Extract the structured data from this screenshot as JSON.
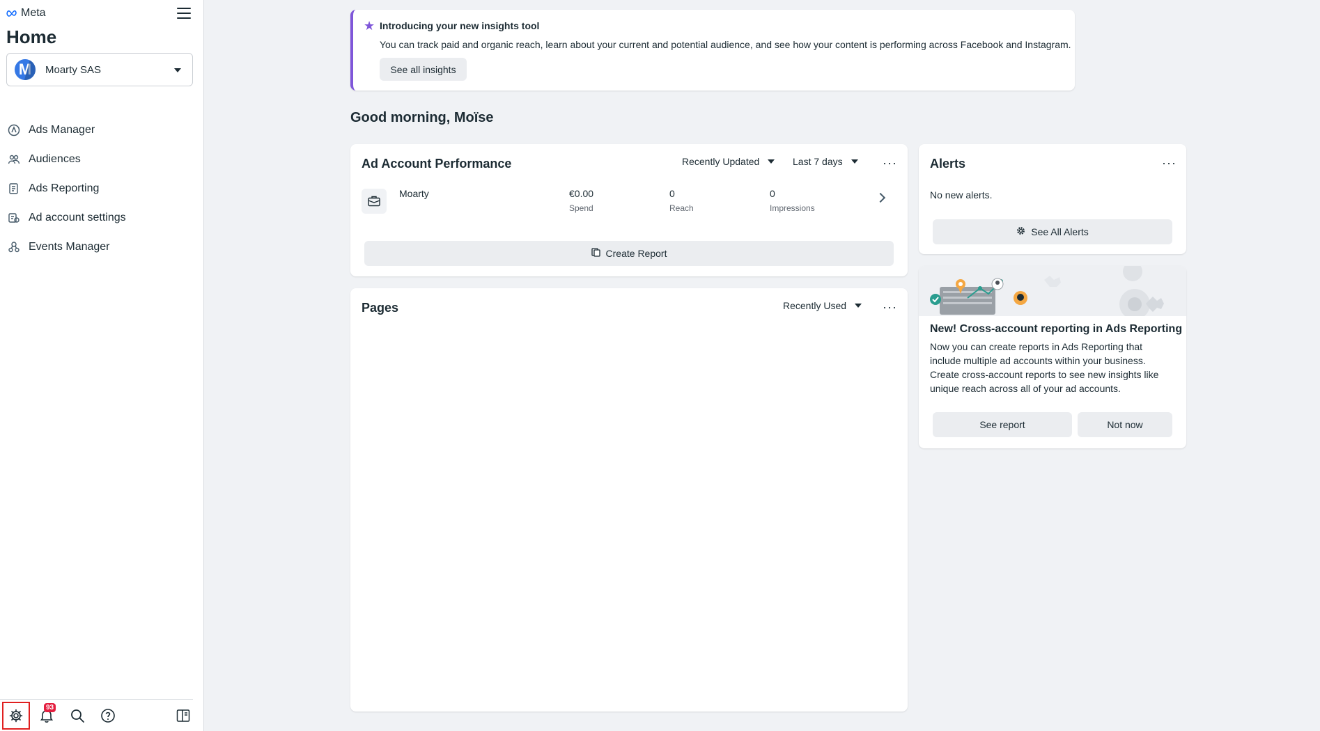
{
  "brand": {
    "name": "Meta"
  },
  "sidebar": {
    "title": "Home",
    "account": {
      "name": "Moarty SAS",
      "avatar_letter": "M"
    },
    "items": [
      {
        "label": "Ads Manager",
        "icon": "ads-manager-icon"
      },
      {
        "label": "Audiences",
        "icon": "audiences-icon"
      },
      {
        "label": "Ads Reporting",
        "icon": "ads-reporting-icon"
      },
      {
        "label": "Ad account settings",
        "icon": "ad-account-settings-icon"
      },
      {
        "label": "Events Manager",
        "icon": "events-manager-icon"
      }
    ],
    "bottom": {
      "notifications_badge": "93"
    }
  },
  "banner": {
    "title": "Introducing your new insights tool",
    "text": "You can track paid and organic reach, learn about your current and potential audience, and see how your content is performing across Facebook and Instagram.",
    "button": "See all insights"
  },
  "greeting": "Good morning, Moïse",
  "performance": {
    "title": "Ad Account Performance",
    "sort": "Recently Updated",
    "range": "Last 7 days",
    "row": {
      "name": "Moarty",
      "spend_value": "€0.00",
      "spend_label": "Spend",
      "reach_value": "0",
      "reach_label": "Reach",
      "impressions_value": "0",
      "impressions_label": "Impressions"
    },
    "button": "Create Report"
  },
  "pages": {
    "title": "Pages",
    "sort": "Recently Used"
  },
  "alerts": {
    "title": "Alerts",
    "text": "No new alerts.",
    "button": "See All Alerts"
  },
  "promo": {
    "title": "New! Cross-account reporting in Ads Reporting",
    "text": "Now you can create reports in Ads Reporting that include multiple ad accounts within your business. Create cross-account reports to see new insights like unique reach across all of your ad accounts.",
    "primary": "See report",
    "secondary": "Not now"
  },
  "colors": {
    "accent": "#7f56d9",
    "badge": "#e41e3f",
    "highlight": "#e02020"
  }
}
